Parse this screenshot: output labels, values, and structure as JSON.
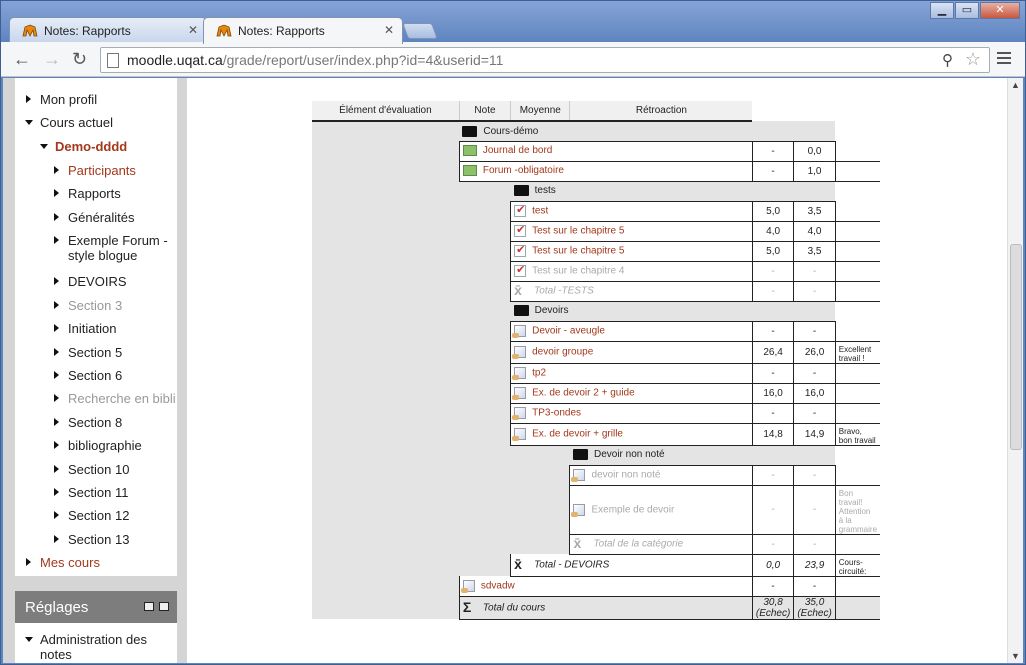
{
  "tabs": [
    {
      "title": "Notes: Rapports"
    },
    {
      "title": "Notes: Rapports"
    }
  ],
  "url": {
    "host": "moodle.uqat.ca",
    "path": "/grade/report/user/index.php?id=4&userid=11"
  },
  "nav": [
    {
      "label": "Mon profil",
      "level": 0,
      "expanded": false,
      "style": "normal"
    },
    {
      "label": "Cours actuel",
      "level": 0,
      "expanded": true,
      "style": "normal"
    },
    {
      "label": "Demo-dddd",
      "level": 1,
      "expanded": true,
      "style": "active"
    },
    {
      "label": "Participants",
      "level": 2,
      "expanded": false,
      "style": "link"
    },
    {
      "label": "Rapports",
      "level": 2,
      "expanded": false,
      "style": "normal"
    },
    {
      "label": "Généralités",
      "level": 2,
      "expanded": false,
      "style": "normal"
    },
    {
      "label": "Exemple Forum -",
      "label2": "style blogue",
      "level": 2,
      "expanded": false,
      "style": "normal"
    },
    {
      "label": "DEVOIRS",
      "level": 2,
      "expanded": false,
      "style": "normal"
    },
    {
      "label": "Section 3",
      "level": 2,
      "expanded": false,
      "style": "dim"
    },
    {
      "label": "Initiation",
      "level": 2,
      "expanded": false,
      "style": "normal"
    },
    {
      "label": "Section 5",
      "level": 2,
      "expanded": false,
      "style": "normal"
    },
    {
      "label": "Section 6",
      "level": 2,
      "expanded": false,
      "style": "normal"
    },
    {
      "label": "Recherche en bibli",
      "level": 2,
      "expanded": false,
      "style": "dim"
    },
    {
      "label": "Section 8",
      "level": 2,
      "expanded": false,
      "style": "normal"
    },
    {
      "label": "bibliographie",
      "level": 2,
      "expanded": false,
      "style": "normal"
    },
    {
      "label": "Section 10",
      "level": 2,
      "expanded": false,
      "style": "normal"
    },
    {
      "label": "Section 11",
      "level": 2,
      "expanded": false,
      "style": "normal"
    },
    {
      "label": "Section 12",
      "level": 2,
      "expanded": false,
      "style": "normal"
    },
    {
      "label": "Section 13",
      "level": 2,
      "expanded": false,
      "style": "normal"
    },
    {
      "label": "Mes cours",
      "level": 0,
      "expanded": false,
      "style": "link"
    }
  ],
  "settings": {
    "title": "Réglages",
    "item": "Administration des",
    "item2": "notes"
  },
  "table": {
    "headers": [
      "Élément d'évaluation",
      "Note",
      "Moyenne",
      "Rétroaction"
    ],
    "rows": [
      {
        "type": "cat",
        "depth": 0,
        "name": "Cours-démo"
      },
      {
        "type": "item",
        "depth": 0,
        "icon": "forum",
        "name": "Journal de bord",
        "note": "-",
        "avg": "0,0",
        "fb": ""
      },
      {
        "type": "item",
        "depth": 0,
        "icon": "forum",
        "name": "Forum -obligatoire",
        "note": "-",
        "avg": "1,0",
        "fb": ""
      },
      {
        "type": "cat",
        "depth": 1,
        "name": "tests"
      },
      {
        "type": "item",
        "depth": 1,
        "icon": "chk",
        "name": "test",
        "note": "5,0",
        "avg": "3,5",
        "fb": ""
      },
      {
        "type": "item",
        "depth": 1,
        "icon": "chk",
        "name": "Test sur le chapitre 5",
        "note": "4,0",
        "avg": "4,0",
        "fb": ""
      },
      {
        "type": "item",
        "depth": 1,
        "icon": "chk",
        "name": "Test sur le chapitre 5",
        "note": "5,0",
        "avg": "3,5",
        "fb": ""
      },
      {
        "type": "item",
        "depth": 1,
        "icon": "chk",
        "name": "Test sur le chapitre 4",
        "note": "-",
        "avg": "-",
        "fb": "",
        "dim": true
      },
      {
        "type": "total",
        "depth": 1,
        "name": "Total -TESTS",
        "note": "-",
        "avg": "-",
        "fb": "",
        "dim": true
      },
      {
        "type": "cat",
        "depth": 1,
        "name": "Devoirs"
      },
      {
        "type": "item",
        "depth": 1,
        "icon": "doc",
        "name": "Devoir - aveugle",
        "note": "-",
        "avg": "-",
        "fb": ""
      },
      {
        "type": "item",
        "depth": 1,
        "icon": "doc",
        "name": "devoir groupe",
        "note": "26,4",
        "avg": "26,0",
        "fb": "Excellent travail !"
      },
      {
        "type": "item",
        "depth": 1,
        "icon": "doc",
        "name": "tp2",
        "note": "-",
        "avg": "-",
        "fb": ""
      },
      {
        "type": "item",
        "depth": 1,
        "icon": "doc",
        "name": "Ex. de devoir 2 + guide",
        "note": "16,0",
        "avg": "16,0",
        "fb": ""
      },
      {
        "type": "item",
        "depth": 1,
        "icon": "doc",
        "name": "TP3-ondes",
        "note": "-",
        "avg": "-",
        "fb": ""
      },
      {
        "type": "item",
        "depth": 1,
        "icon": "doc",
        "name": "Ex. de devoir + grille",
        "note": "14,8",
        "avg": "14,9",
        "fb": "Bravo, bon travail"
      },
      {
        "type": "cat",
        "depth": 2,
        "name": "Devoir non noté"
      },
      {
        "type": "item",
        "depth": 2,
        "icon": "doc",
        "name": "devoir non noté",
        "note": "-",
        "avg": "-",
        "fb": "",
        "dim": true
      },
      {
        "type": "item",
        "depth": 2,
        "icon": "doc",
        "name": "Exemple de devoir",
        "note": "-",
        "avg": "-",
        "fb": "Bon travail! Attention à la grammaire",
        "dim": true
      },
      {
        "type": "total",
        "depth": 2,
        "name": "Total de la catégorie",
        "note": "-",
        "avg": "-",
        "fb": "",
        "dim": true
      },
      {
        "type": "total",
        "depth": 1,
        "name": "Total - DEVOIRS",
        "note": "0,0",
        "avg": "23,9",
        "fb": "Cours-circuité:"
      },
      {
        "type": "item",
        "depth": 0,
        "icon": "doc",
        "name": "sdvadw",
        "note": "-",
        "avg": "-",
        "fb": ""
      },
      {
        "type": "course",
        "depth": 0,
        "name": "Total du cours",
        "note": "30,8 (Echec)",
        "avg": "35,0 (Echec)",
        "fb": ""
      }
    ]
  }
}
